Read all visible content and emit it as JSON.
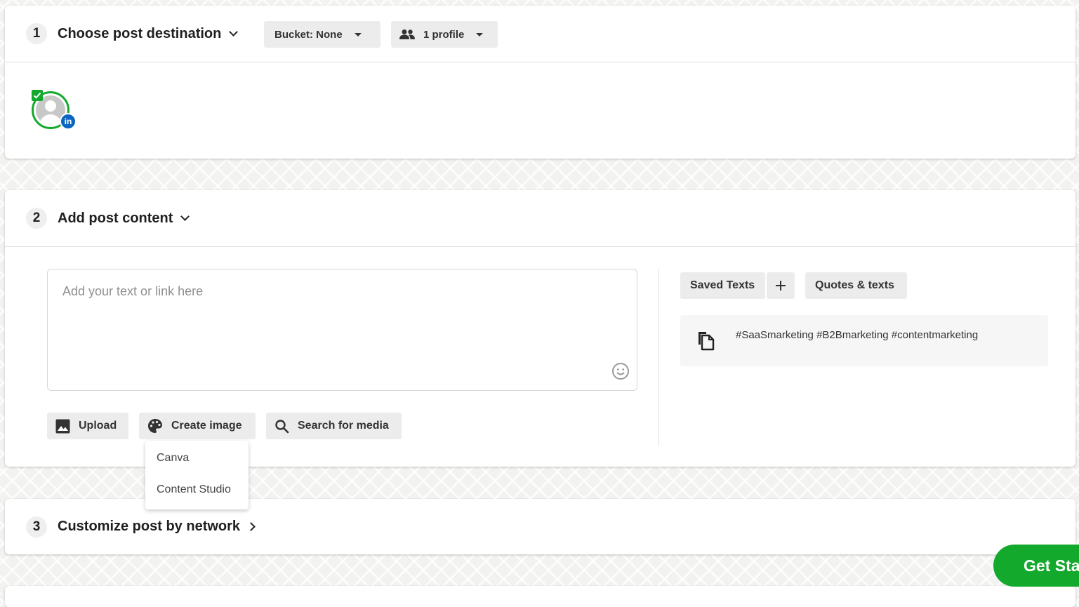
{
  "colors": {
    "accent_green": "#13a92c",
    "linkedin_blue": "#0a66c2",
    "pill_bg": "#ececec"
  },
  "step1": {
    "number": "1",
    "title": "Choose post destination",
    "bucket_label": "Bucket: None",
    "profile_label": "1 profile",
    "profile_avatar": {
      "icon": "person-icon",
      "network_badge": "in",
      "selected": true
    }
  },
  "step2": {
    "number": "2",
    "title": "Add post content",
    "text_placeholder": "Add your text or link here",
    "buttons": {
      "upload": "Upload",
      "create_image": "Create image",
      "search_media": "Search for media"
    },
    "create_image_menu": [
      "Canva",
      "Content Studio"
    ],
    "saved_texts_tab": "Saved Texts",
    "quotes_tab": "Quotes & texts",
    "saved_text_item": "#SaaSmarketing #B2Bmarketing #contentmarketing"
  },
  "step3": {
    "number": "3",
    "title": "Customize post by network"
  },
  "cta": {
    "label": "Get Started"
  }
}
